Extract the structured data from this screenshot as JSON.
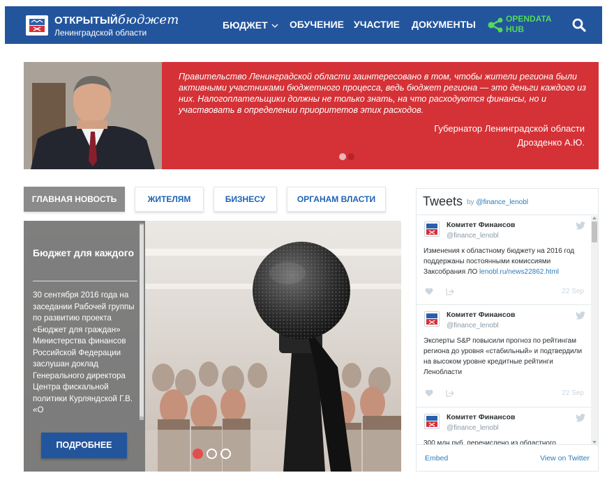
{
  "header": {
    "logo_title": "ОТКРЫТЫЙ",
    "logo_script": "бюджет",
    "logo_subtitle": "Ленинградской области",
    "nav": {
      "budget": "БЮДЖЕТ",
      "learning": "ОБУЧЕНИЕ",
      "participation": "УЧАСТИЕ",
      "documents": "ДОКУМЕНТЫ"
    },
    "opendata_line1": "OPENDATA",
    "opendata_line2": "HUB",
    "icons": {
      "emblem": "emblem-icon",
      "share": "share-network-icon",
      "search": "search-icon",
      "chevron": "chevron-down-icon"
    },
    "colors": {
      "bar": "#23559d",
      "opendata": "#54d95a"
    }
  },
  "hero": {
    "quote": "Правительство Ленинградской области заинтересовано в том, чтобы жители региона были активными участниками бюджетного процесса, ведь бюджет региона — это деньги каждого из них. Налогоплательщики должны не только знать, на что расходуются финансы, но и участвовать в определении приоритетов этих расходов.",
    "author_title": "Губернатор Ленинградской области",
    "author_name": "Дрозденко А.Ю.",
    "color": "#d43237"
  },
  "tabs": {
    "main_news": "ГЛАВНАЯ НОВОСТЬ",
    "residents": "ЖИТЕЛЯМ",
    "business": "БИЗНЕСУ",
    "government": "ОРГАНАМ ВЛАСТИ"
  },
  "news": {
    "title": "Бюджет для каждого",
    "body": "30 сентября 2016 года на заседании Рабочей группы по развитию проекта «Бюджет для граждан» Министерства финансов Российской Федерации заслушан доклад Генерального директора Центра фискальной политики Курляндской Г.В. «О",
    "more_button": "ПОДРОБНЕЕ",
    "slides_total": 3,
    "active_slide": 1
  },
  "tweets": {
    "title": "Tweets",
    "by": "by",
    "account": "@finance_lenobl",
    "items": [
      {
        "name": "Комитет Финансов",
        "handle": "@finance_lenobl",
        "text": "Изменения к областному бюджету на 2016 год поддержаны постоянными комиссиями Заксобрания ЛО ",
        "link": "lenobl.ru/news22862.html",
        "date": "22 Sep"
      },
      {
        "name": "Комитет Финансов",
        "handle": "@finance_lenobl",
        "text": "Эксперты S&P повысили прогноз по рейтингам региона до уровня «стабильный» и подтвердили на высоком уровне кредитные рейтинги Ленобласти",
        "link": "",
        "date": "22 Sep"
      },
      {
        "name": "Комитет Финансов",
        "handle": "@finance_lenobl",
        "text": "300 млн руб. перечислено из областного",
        "link": "",
        "date": ""
      }
    ],
    "embed": "Embed",
    "view_on_twitter": "View on Twitter",
    "colors": {
      "link": "#2b7bb9",
      "muted": "#8899a6"
    }
  }
}
